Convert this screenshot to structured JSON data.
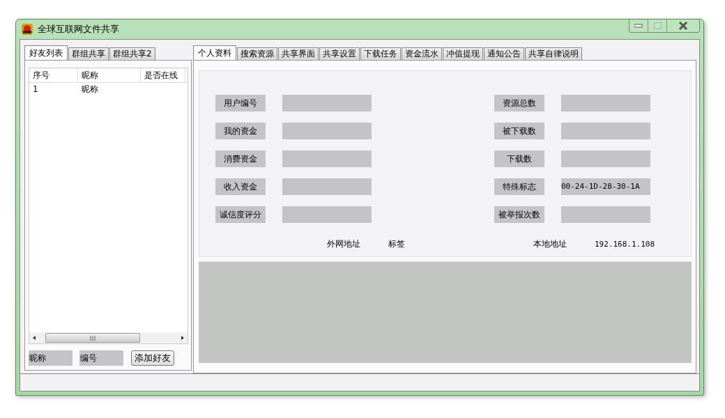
{
  "window": {
    "title": "全球互联网文件共享"
  },
  "left_tabs": [
    {
      "label": "好友列表",
      "selected": true
    },
    {
      "label": "群组共享",
      "selected": false
    },
    {
      "label": "群组共享2",
      "selected": false
    }
  ],
  "friends_table": {
    "columns": [
      "序号",
      "昵称",
      "是否在线"
    ],
    "rows": [
      [
        "1",
        "昵称"
      ]
    ]
  },
  "add_friend": {
    "nickname_field": "昵称",
    "id_field": "编号",
    "button": "添加好友"
  },
  "main_tabs": [
    {
      "label": "个人资料",
      "selected": true
    },
    {
      "label": "搜索资源",
      "selected": false
    },
    {
      "label": "共享界面",
      "selected": false
    },
    {
      "label": "共享设置",
      "selected": false
    },
    {
      "label": "下载任务",
      "selected": false
    },
    {
      "label": "资金流水",
      "selected": false
    },
    {
      "label": "冲值提现",
      "selected": false
    },
    {
      "label": "通知公告",
      "selected": false
    },
    {
      "label": "共享自律说明",
      "selected": false
    }
  ],
  "profile": {
    "left_fields": [
      {
        "label": "用户编号"
      },
      {
        "label": "我的资金"
      },
      {
        "label": "消费资金"
      },
      {
        "label": "收入资金"
      },
      {
        "label": "诚信度评分"
      }
    ],
    "right_fields": [
      {
        "label": "资源总数"
      },
      {
        "label": "被下载数"
      },
      {
        "label": "下载数"
      },
      {
        "label": "特殊标志",
        "value": "00-24-1D-28-30-1A"
      },
      {
        "label": "被举报次数"
      }
    ]
  },
  "address": {
    "wan_label": "外网地址",
    "wan_value": "标签",
    "local_label": "本地地址",
    "local_value": "192.168.1.108"
  }
}
